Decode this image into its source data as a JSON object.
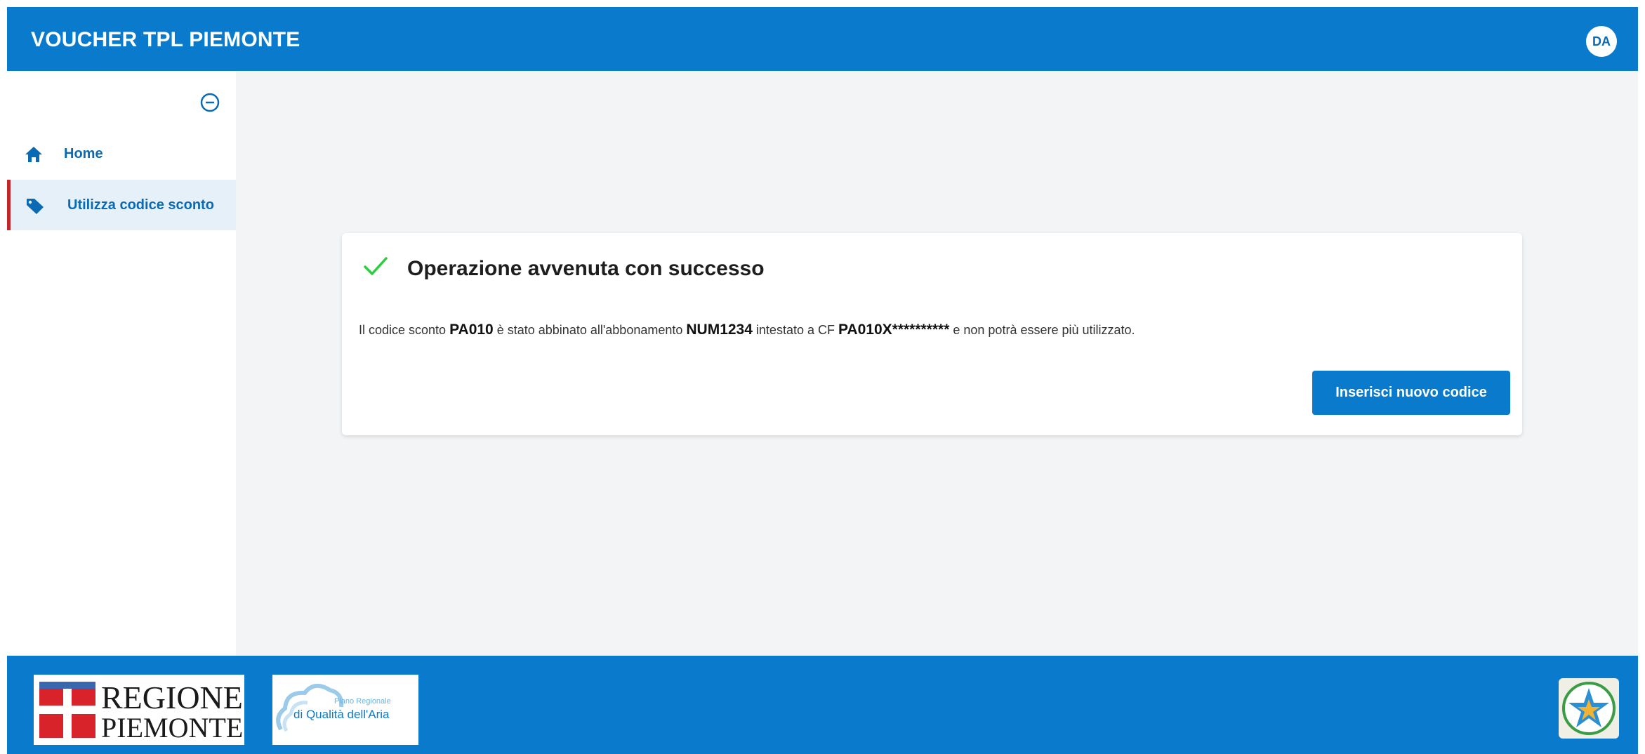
{
  "header": {
    "title": "VOUCHER TPL PIEMONTE",
    "user_initials": "DA"
  },
  "sidebar": {
    "items": [
      {
        "label": "Home",
        "icon": "home-icon"
      },
      {
        "label": "Utilizza codice sconto",
        "icon": "tag-icon",
        "active": true
      }
    ],
    "collapse_icon": "minus-circle-icon"
  },
  "result": {
    "title": "Operazione avvenuta con successo",
    "message": {
      "part1": "Il codice sconto ",
      "code": "PA010",
      "part2": " è stato abbinato all'abbonamento ",
      "subscription": "NUM1234",
      "part3": " intestato a CF ",
      "cf": "PA010X**********",
      "part4": " e non potrà essere più utilizzato."
    },
    "button_label": "Inserisci nuovo codice"
  },
  "footer": {
    "logo_regione_line1": "REGIONE",
    "logo_regione_line2": "PIEMONTE",
    "logo_aria_line1": "Piano Regionale",
    "logo_aria_line2": "di Qualità dell'Aria"
  },
  "colors": {
    "primary": "#0a7bcc",
    "active_indicator": "#c0272d",
    "success": "#2ecc40"
  }
}
